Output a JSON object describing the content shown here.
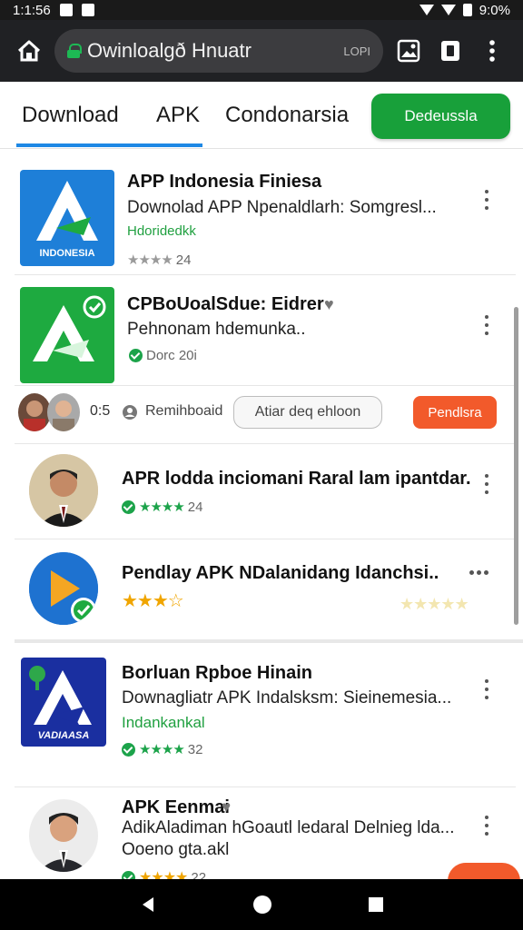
{
  "status_bar": {
    "time": "1:1:56",
    "battery": "9:0%"
  },
  "browser": {
    "url": "Owinloalgð Hnuatr",
    "url_extra": "LOPI"
  },
  "tabs": [
    {
      "label": "Download",
      "selected": true
    },
    {
      "label": "APK",
      "selected": false
    },
    {
      "label": "Condonarsia",
      "selected": false
    }
  ],
  "tab_action_label": "Dedeussla",
  "items": [
    {
      "title": "APP Indonesia Finiesa",
      "subtitle": "Downolad APP Npenaldlarh: Somgresl...",
      "developer": "Hdoridedkk",
      "rating": "24",
      "icon_label": "INDONESIA"
    },
    {
      "title": "CPBoUoalSdue: Eidrer",
      "subtitle": "Pehnonam hdemunka..",
      "rating_text": "Dorc 20i"
    },
    {
      "title": "APR lodda inciomani Raral lam ipantdar.",
      "rating": "24"
    },
    {
      "title": "Pendlay APK NDalanidang Idanchsi..",
      "stars": 3.5
    },
    {
      "title": "Borluan Rpboe Hinain",
      "subtitle": "Downagliatr APK Indalsksm: Sieinemesia...",
      "developer": "Indankankal",
      "rating": "32",
      "icon_label": "VADIAASA"
    },
    {
      "title": "APK Eenmai",
      "subtitle": "AdikAladiman hGoautl ledaral Delnieg lda...",
      "subtitle2": "Ooeno gta.akl",
      "rating": "22"
    }
  ],
  "promo": {
    "count": "0:5",
    "label": "Remihboaid",
    "input_text": "Atiar deq ehloon",
    "button": "Pendlsra"
  },
  "colors": {
    "accent_blue": "#1e88e5",
    "brand_green": "#18a03a",
    "orange": "#f25a2b",
    "app_blue": "#1e7fd8",
    "app_green": "#1eaa40",
    "app_navy": "#1a2fa0"
  }
}
